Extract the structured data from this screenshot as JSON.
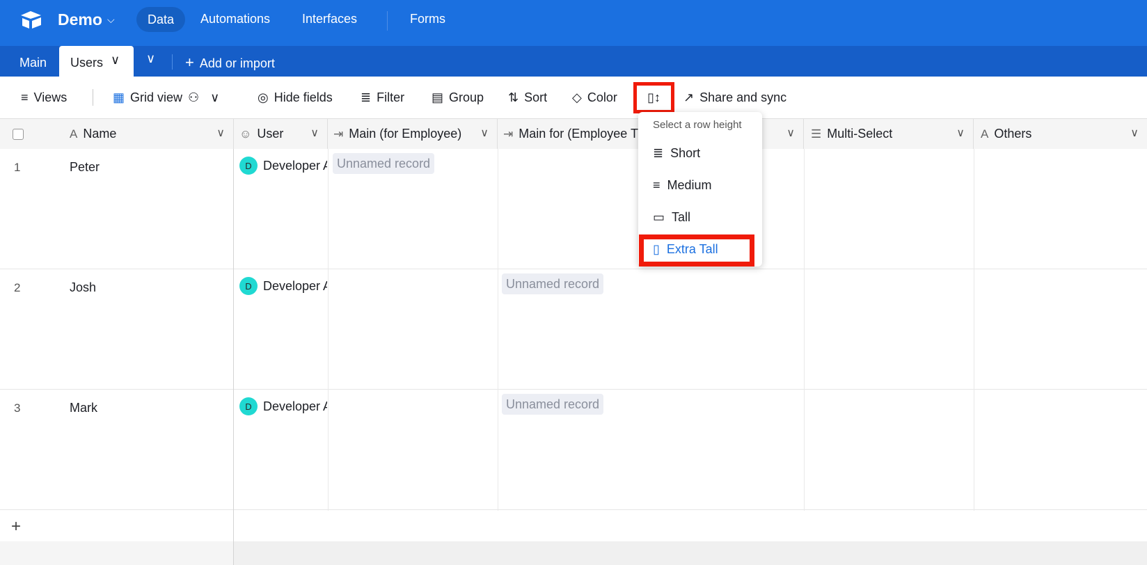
{
  "app": {
    "base_name": "Demo",
    "nav": [
      "Data",
      "Automations",
      "Interfaces",
      "Forms"
    ],
    "brand_color": "#1b70e0"
  },
  "tabs": {
    "items": [
      "Main",
      "Users"
    ],
    "active": "Users",
    "add_label": "Add or import"
  },
  "toolbar": {
    "views": "Views",
    "grid_view": "Grid view",
    "hide_fields": "Hide fields",
    "filter": "Filter",
    "group": "Group",
    "sort": "Sort",
    "color": "Color",
    "share": "Share and sync"
  },
  "columns": [
    "Name",
    "User",
    "Main (for Employee)",
    "Main for (Employee T",
    "Multi-Select",
    "Others"
  ],
  "rows": [
    {
      "num": "1",
      "name": "Peter",
      "user": "Developer A",
      "main_employee": "Unnamed record",
      "main_for": ""
    },
    {
      "num": "2",
      "name": "Josh",
      "user": "Developer A",
      "main_employee": "",
      "main_for": "Unnamed record"
    },
    {
      "num": "3",
      "name": "Mark",
      "user": "Developer A",
      "main_employee": "",
      "main_for": "Unnamed record"
    }
  ],
  "avatar_letter": "D",
  "row_height_menu": {
    "title": "Select a row height",
    "options": [
      "Short",
      "Medium",
      "Tall",
      "Extra Tall"
    ],
    "selected": "Extra Tall",
    "selected_color": "#1b70e0",
    "highlight_color": "#f01b0a"
  }
}
